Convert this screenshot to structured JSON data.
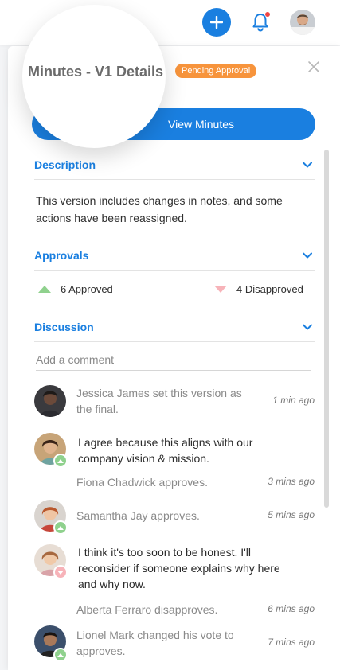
{
  "colors": {
    "accent": "#1a7fe0",
    "badge": "#f7943c",
    "approved": "#8fd18d",
    "disapproved": "#f7b3b9"
  },
  "header": {
    "title": "Minutes - V1 Details",
    "status_badge": "Pending Approval"
  },
  "actions": {
    "view_minutes": "View Minutes"
  },
  "description": {
    "title": "Description",
    "text": "This version includes changes in notes, and some actions have been reassigned."
  },
  "approvals": {
    "title": "Approvals",
    "approved": "6 Approved",
    "disapproved": "4 Disapproved"
  },
  "discussion": {
    "title": "Discussion",
    "placeholder": "Add a comment",
    "items": [
      {
        "event": "Jessica James set this version as the final.",
        "time": "1 min ago"
      },
      {
        "message": "I agree because this aligns with our company vision & mission.",
        "event": "Fiona Chadwick approves.",
        "time": "3 mins ago",
        "vote": "up"
      },
      {
        "event": "Samantha Jay approves.",
        "time": "5 mins ago",
        "vote": "up"
      },
      {
        "message": "I think it's too soon to be honest. I'll reconsider if someone explains why here and why now.",
        "event": "Alberta Ferraro disapproves.",
        "time": "6 mins ago",
        "vote": "down"
      },
      {
        "event": "Lionel Mark changed his vote to approves.",
        "time": "7 mins ago",
        "vote": "up"
      }
    ]
  }
}
